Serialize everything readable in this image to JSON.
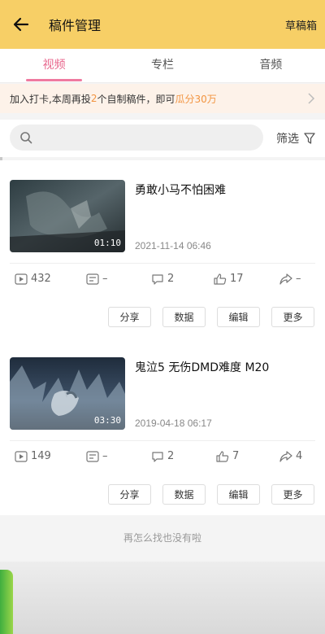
{
  "header": {
    "title": "稿件管理",
    "drafts_label": "草稿箱"
  },
  "tabs": [
    {
      "label": "视频",
      "active": true
    },
    {
      "label": "专栏",
      "active": false
    },
    {
      "label": "音频",
      "active": false
    }
  ],
  "banner": {
    "prefix": "加入打卡,本周再投",
    "count": "2",
    "middle": "个自制稿件，即可",
    "reward": "瓜分30万"
  },
  "search": {
    "placeholder": "",
    "filter_label": "筛选"
  },
  "videos": [
    {
      "title": "勇敢小马不怕困难",
      "duration": "01:10",
      "date": "2021-11-14 06:46",
      "plays": "432",
      "danmaku": "–",
      "comments": "2",
      "likes": "17",
      "shares": "–"
    },
    {
      "title": "鬼泣5 无伤DMD难度 M20",
      "duration": "03:30",
      "date": "2019-04-18 06:17",
      "plays": "149",
      "danmaku": "–",
      "comments": "2",
      "likes": "7",
      "shares": "4"
    }
  ],
  "actions": {
    "share": "分享",
    "data": "数据",
    "edit": "编辑",
    "more": "更多"
  },
  "footer": {
    "end_text": "再怎么找也没有啦"
  },
  "colors": {
    "header_bg": "#f7cf66",
    "accent_pink": "#e8678d",
    "highlight_orange": "#f29440"
  }
}
